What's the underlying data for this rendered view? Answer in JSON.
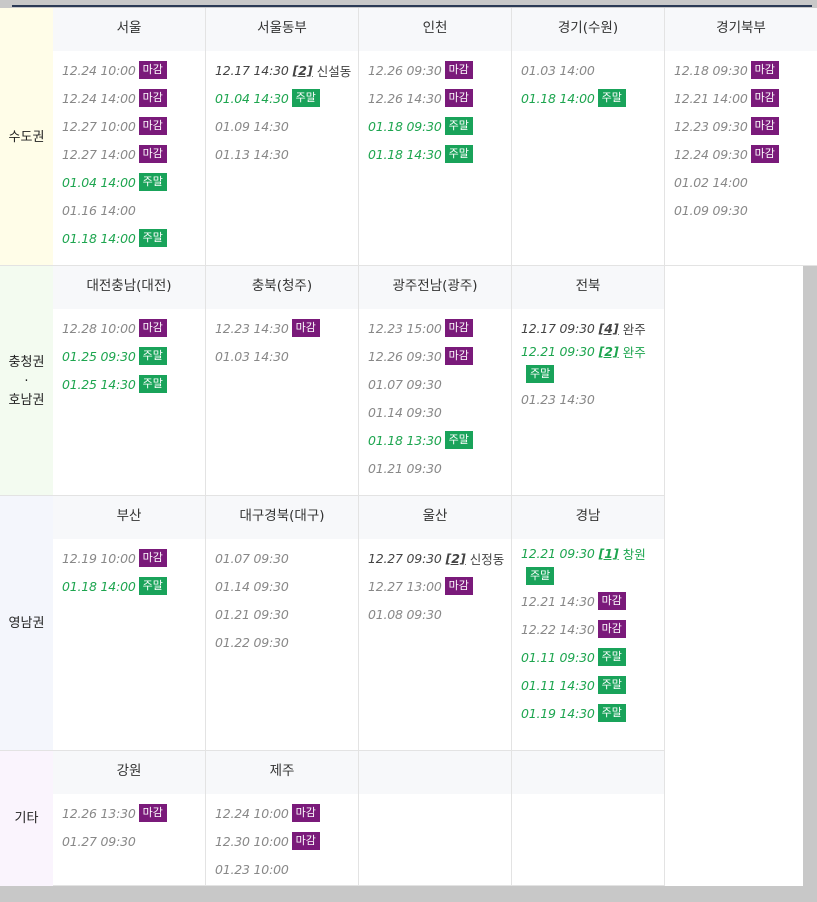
{
  "regions": [
    {
      "label": "수도권",
      "bg": "#fffde8"
    },
    {
      "label": "충청권\n·\n호남권",
      "bg": "#f3fbf0"
    },
    {
      "label": "영남권",
      "bg": "#f4f6fc"
    },
    {
      "label": "기타",
      "bg": "#faf4fd"
    }
  ],
  "badges": {
    "closed": "마감",
    "weekend": "주말"
  },
  "colors": {
    "closed": "#7a1a7a",
    "weekend": "#19a35a",
    "header_bg": "#f7f8fa"
  },
  "rows": [
    [
      {
        "name": "서울",
        "entries": [
          {
            "t": "12.24 10:00",
            "b": "closed"
          },
          {
            "t": "12.24 14:00",
            "b": "closed"
          },
          {
            "t": "12.27 10:00",
            "b": "closed"
          },
          {
            "t": "12.27 14:00",
            "b": "closed"
          },
          {
            "t": "01.04 14:00",
            "b": "weekend",
            "s": "green"
          },
          {
            "t": "01.16 14:00"
          },
          {
            "t": "01.18 14:00",
            "b": "weekend",
            "s": "green"
          }
        ]
      },
      {
        "name": "서울동부",
        "entries": [
          {
            "t": "12.17 14:30",
            "br": "[2]",
            "p": "신설동",
            "s": "bold"
          },
          {
            "t": "01.04 14:30",
            "b": "weekend",
            "s": "green"
          },
          {
            "t": "01.09 14:30"
          },
          {
            "t": "01.13 14:30"
          }
        ]
      },
      {
        "name": "인천",
        "entries": [
          {
            "t": "12.26 09:30",
            "b": "closed"
          },
          {
            "t": "12.26 14:30",
            "b": "closed"
          },
          {
            "t": "01.18 09:30",
            "b": "weekend",
            "s": "green"
          },
          {
            "t": "01.18 14:30",
            "b": "weekend",
            "s": "green"
          }
        ]
      },
      {
        "name": "경기(수원)",
        "entries": [
          {
            "t": "01.03 14:00"
          },
          {
            "t": "01.18 14:00",
            "b": "weekend",
            "s": "green"
          }
        ]
      },
      {
        "name": "경기북부",
        "entries": [
          {
            "t": "12.18 09:30",
            "b": "closed"
          },
          {
            "t": "12.21 14:00",
            "b": "closed"
          },
          {
            "t": "12.23 09:30",
            "b": "closed"
          },
          {
            "t": "12.24 09:30",
            "b": "closed"
          },
          {
            "t": "01.02 14:00"
          },
          {
            "t": "01.09 09:30"
          }
        ]
      }
    ],
    [
      {
        "name": "대전충남(대전)",
        "entries": [
          {
            "t": "12.28 10:00",
            "b": "closed"
          },
          {
            "t": "01.25 09:30",
            "b": "weekend",
            "s": "green"
          },
          {
            "t": "01.25 14:30",
            "b": "weekend",
            "s": "green"
          }
        ]
      },
      {
        "name": "충북(청주)",
        "entries": [
          {
            "t": "12.23 14:30",
            "b": "closed"
          },
          {
            "t": "01.03 14:30"
          }
        ]
      },
      {
        "name": "광주전남(광주)",
        "entries": [
          {
            "t": "12.23 15:00",
            "b": "closed"
          },
          {
            "t": "12.26 09:30",
            "b": "closed"
          },
          {
            "t": "01.07 09:30"
          },
          {
            "t": "01.14 09:30"
          },
          {
            "t": "01.18 13:30",
            "b": "weekend",
            "s": "green"
          },
          {
            "t": "01.21 09:30"
          }
        ]
      },
      {
        "name": "전북",
        "entries": [
          {
            "t": "12.17 09:30",
            "br": "[4]",
            "p": "완주",
            "s": "bold"
          },
          {
            "t": "12.21 09:30",
            "br": "[2]",
            "p": "완주",
            "s": "green",
            "b": "weekend",
            "wrap": true
          },
          {
            "t": "01.23 14:30"
          }
        ]
      }
    ],
    [
      {
        "name": "부산",
        "entries": [
          {
            "t": "12.19 10:00",
            "b": "closed"
          },
          {
            "t": "01.18 14:00",
            "b": "weekend",
            "s": "green"
          }
        ]
      },
      {
        "name": "대구경북(대구)",
        "entries": [
          {
            "t": "01.07 09:30"
          },
          {
            "t": "01.14 09:30"
          },
          {
            "t": "01.21 09:30"
          },
          {
            "t": "01.22 09:30"
          }
        ]
      },
      {
        "name": "울산",
        "entries": [
          {
            "t": "12.27 09:30",
            "br": "[2]",
            "p": "신정동",
            "s": "bold"
          },
          {
            "t": "12.27 13:00",
            "b": "closed"
          },
          {
            "t": "01.08 09:30"
          }
        ]
      },
      {
        "name": "경남",
        "entries": [
          {
            "t": "12.21 09:30",
            "br": "[1]",
            "p": "창원",
            "s": "green",
            "b": "weekend",
            "wrap": true
          },
          {
            "t": "12.21 14:30",
            "b": "closed"
          },
          {
            "t": "12.22 14:30",
            "b": "closed"
          },
          {
            "t": "01.11 09:30",
            "b": "weekend",
            "s": "green"
          },
          {
            "t": "01.11 14:30",
            "b": "weekend",
            "s": "green"
          },
          {
            "t": "01.19 14:30",
            "b": "weekend",
            "s": "green"
          }
        ]
      }
    ],
    [
      {
        "name": "강원",
        "entries": [
          {
            "t": "12.26 13:30",
            "b": "closed"
          },
          {
            "t": "01.27 09:30"
          }
        ]
      },
      {
        "name": "제주",
        "entries": [
          {
            "t": "12.24 10:00",
            "b": "closed"
          },
          {
            "t": "12.30 10:00",
            "b": "closed"
          },
          {
            "t": "01.23 10:00"
          }
        ]
      },
      {
        "name": "",
        "entries": []
      },
      {
        "name": "",
        "entries": []
      }
    ]
  ]
}
